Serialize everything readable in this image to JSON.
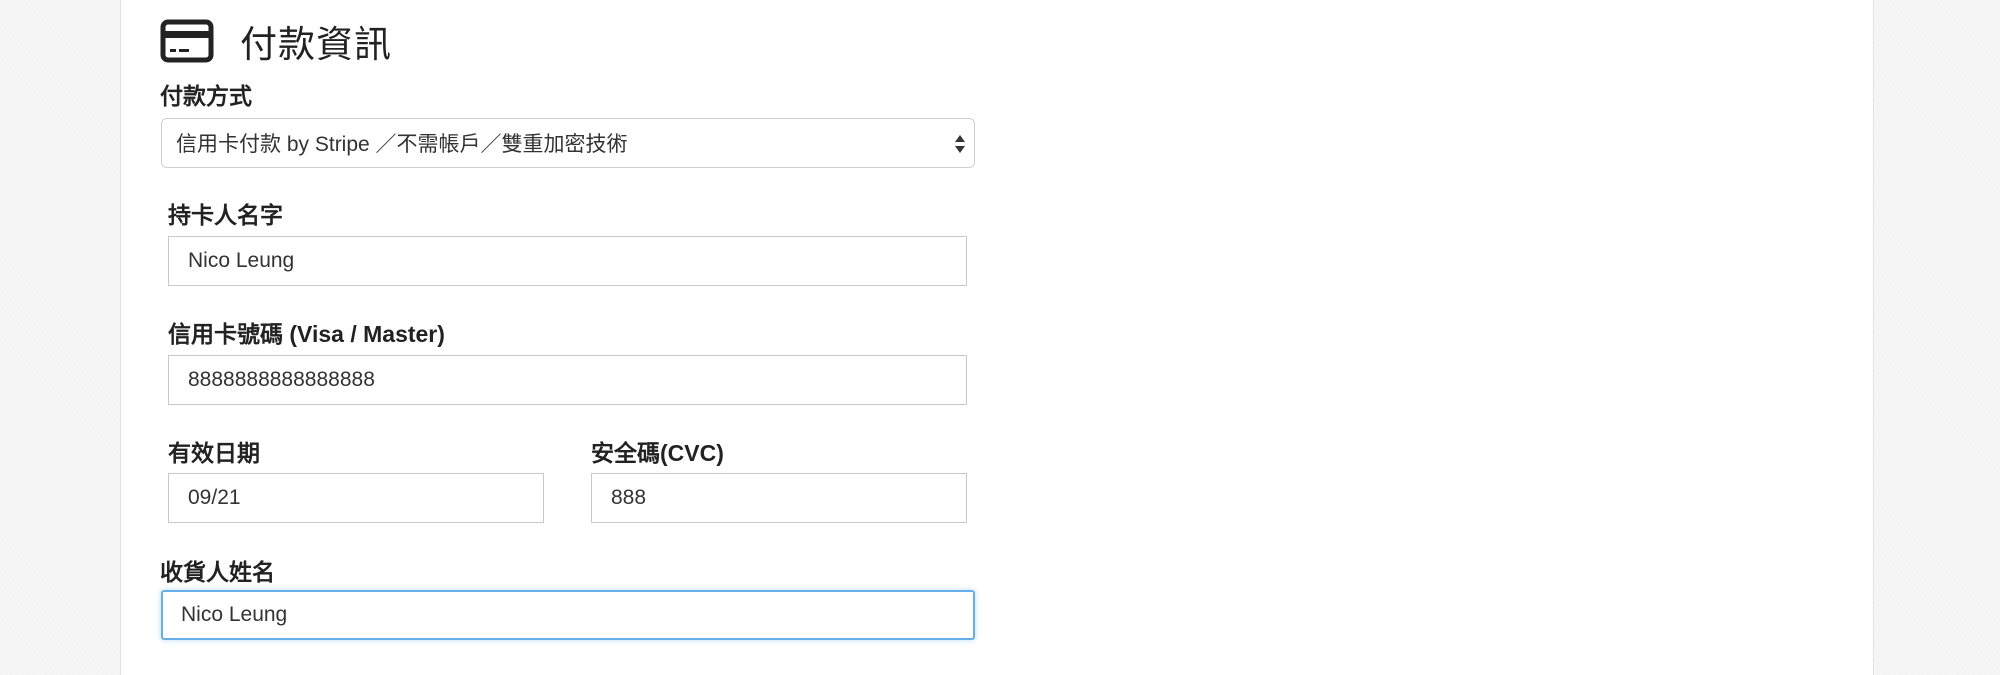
{
  "section": {
    "title": "付款資訊",
    "icon": "credit-card-icon"
  },
  "payment_method": {
    "label": "付款方式",
    "selected": "信用卡付款 by Stripe ／不需帳戶／雙重加密技術"
  },
  "cardholder": {
    "label": "持卡人名字",
    "value": "Nico Leung"
  },
  "card_number": {
    "label": "信用卡號碼 (Visa / Master)",
    "value": "8888888888888888"
  },
  "expiry": {
    "label": "有效日期",
    "value": "09/21"
  },
  "cvc": {
    "label": "安全碼(CVC)",
    "value": "888"
  },
  "recipient": {
    "label": "收貨人姓名",
    "value": "Nico Leung"
  },
  "colors": {
    "focus_border": "#66afe9",
    "border": "#c9c9c9",
    "text": "#222222"
  }
}
